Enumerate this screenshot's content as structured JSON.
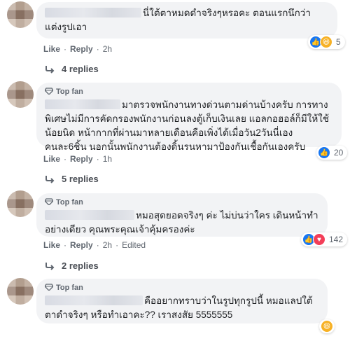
{
  "comments": [
    {
      "text": "นี่ใต้ตาหมดดำจริงๆหรอคะ ตอนแรกนึกว่า แต่งรูปเอา",
      "actions": {
        "like": "Like",
        "reply": "Reply",
        "time": "2h"
      },
      "reactions": {
        "icons": [
          "like-icon",
          "haha-icon"
        ],
        "count": "5"
      },
      "replies": "4 replies"
    },
    {
      "badge": "Top fan",
      "text": "มาตรวจพนักงานทางด่วนตามด่านบ้างครับ การทางพิเศษไม่มีการคัดกรองพนักงานก่อนลงตู้เก็บเงินเลย แอลกอฮอล์ก็มีให้ใช้น้อยนิด หน้ากากที่ผ่านมาหลายเดือนคือเพิ่งได้เมื่อวัน2วันนี่เองคนละ6ชิ้น นอกนั้นพนักงานต้องดิ้นรนหามาป้องกันเชื้อกันเองครับ",
      "actions": {
        "like": "Like",
        "reply": "Reply",
        "time": "1h"
      },
      "reactions": {
        "icons": [
          "like-icon"
        ],
        "count": "20"
      },
      "replies": "5 replies"
    },
    {
      "badge": "Top fan",
      "text": "หมอสุดยอดจริงๆ ค่ะ ไม่บ่นว่าใคร เดินหน้าทำอย่างเดียว คุณพระคุณเจ้าคุ้มครองค่ะ",
      "actions": {
        "like": "Like",
        "reply": "Reply",
        "time": "2h",
        "edited": "Edited"
      },
      "reactions": {
        "icons": [
          "like-icon",
          "love-icon"
        ],
        "count": "142"
      },
      "replies": "2 replies"
    },
    {
      "badge": "Top fan",
      "text": "คืออยากทราบว่าในรูปทุกรูปนี้ หมอแลปใต้ตาดำจริงๆ หรือทำเอาคะ?? เราสงสัย 5555555",
      "reactions": {
        "icons": [
          "haha-icon"
        ]
      }
    }
  ]
}
